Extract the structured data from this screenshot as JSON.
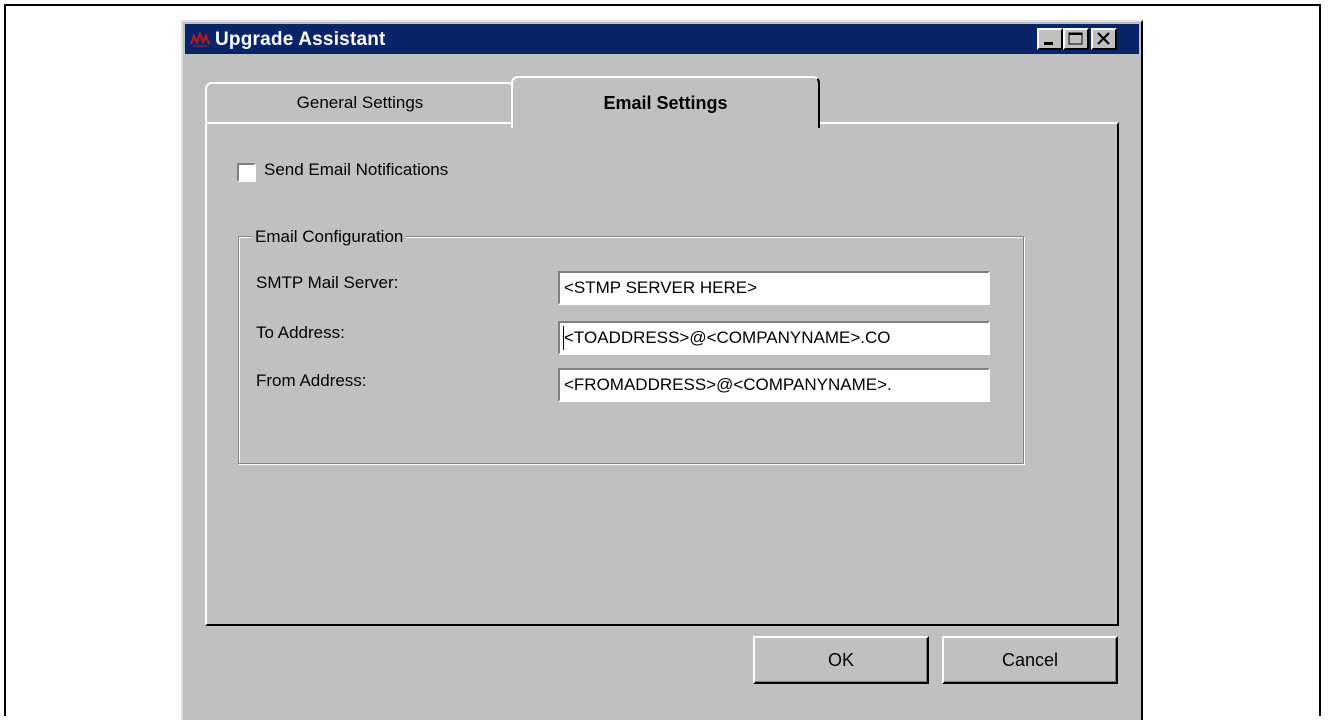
{
  "window": {
    "title": "Upgrade Assistant",
    "controls": [
      "minimize-icon",
      "maximize-icon",
      "close-icon"
    ],
    "titlebar_color": "#0a246a"
  },
  "tabs": [
    {
      "label": "General Settings",
      "selected": false
    },
    {
      "label": "Email Settings",
      "selected": true
    }
  ],
  "email_settings": {
    "send_notifications": {
      "label": "Send Email Notifications",
      "checked": false
    },
    "group_title": "Email Configuration",
    "smtp": {
      "label": "SMTP Mail Server:",
      "value": "<STMP SERVER HERE>"
    },
    "to": {
      "label": "To Address:",
      "value": "<TOADDRESS>@<COMPANYNAME>.CO"
    },
    "from": {
      "label": "From Address:",
      "value": "<FROMADDRESS>@<COMPANYNAME>."
    }
  },
  "buttons": {
    "ok": "OK",
    "cancel": "Cancel"
  }
}
